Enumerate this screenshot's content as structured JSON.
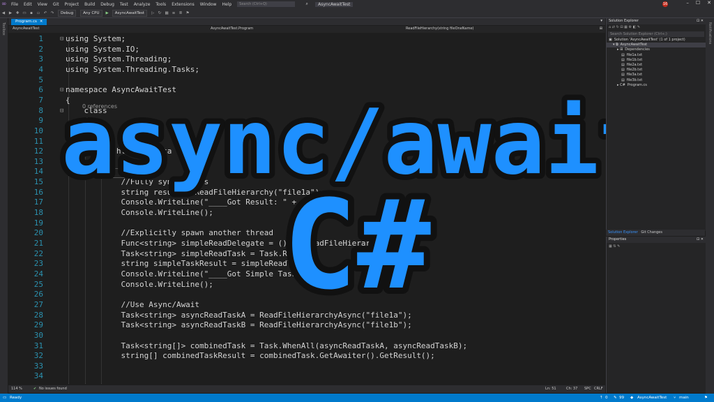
{
  "app": {
    "menu": [
      "File",
      "Edit",
      "View",
      "Git",
      "Project",
      "Build",
      "Debug",
      "Test",
      "Analyze",
      "Tools",
      "Extensions",
      "Window",
      "Help"
    ],
    "search_placeholder": "Search (Ctrl+Q)",
    "window_title": "AsyncAwaitTest",
    "notification_count": "16"
  },
  "toolbar": {
    "config": "Debug",
    "platform": "Any CPU",
    "run_target": "AsyncAwaitTest"
  },
  "side_strips": {
    "left": "Toolbox",
    "right": "Notifications"
  },
  "editor": {
    "tab_label": "Program.cs",
    "nav_project": "AsyncAwaitTest",
    "nav_class": "AsyncAwaitTest.Program",
    "nav_member": "ReadFileHierarchy(string fileOneName)",
    "codelens": "0 references",
    "lines": [
      {
        "n": "1",
        "fold": "⊟",
        "text": "using System;"
      },
      {
        "n": "2",
        "fold": "",
        "text": "using System.IO;"
      },
      {
        "n": "3",
        "fold": "",
        "text": "using System.Threading;"
      },
      {
        "n": "4",
        "fold": "",
        "text": "using System.Threading.Tasks;"
      },
      {
        "n": "5",
        "fold": "",
        "text": ""
      },
      {
        "n": "6",
        "fold": "⊟",
        "text": "namespace AsyncAwaitTest"
      },
      {
        "n": "7",
        "fold": "",
        "text": "{"
      },
      {
        "n": "8",
        "fold": "⊟",
        "text": "    class"
      },
      {
        "n": "9",
        "fold": "",
        "text": "    {"
      },
      {
        "n": "10",
        "fold": "",
        "text": ""
      },
      {
        "n": "11",
        "fold": "",
        "text": ""
      },
      {
        "n": "12",
        "fold": "",
        "text": "        ...hl       sta"
      },
      {
        "n": "13",
        "fold": "",
        "text": "           ...ne();"
      },
      {
        "n": "14",
        "fold": "",
        "text": ""
      },
      {
        "n": "15",
        "fold": "",
        "text": "            //Fully synchronous"
      },
      {
        "n": "16",
        "fold": "",
        "text": "            string result = ReadFileHierarchy(\"file1a\");"
      },
      {
        "n": "17",
        "fold": "",
        "text": "            Console.WriteLine(\"____Got Result: \" + re"
      },
      {
        "n": "18",
        "fold": "",
        "text": "            Console.WriteLine();"
      },
      {
        "n": "19",
        "fold": "",
        "text": ""
      },
      {
        "n": "20",
        "fold": "",
        "text": "            //Explicitly spawn another thread"
      },
      {
        "n": "21",
        "fold": "",
        "text": "            Func<string> simpleReadDelegate = () => ReadFileHierarchy"
      },
      {
        "n": "22",
        "fold": "",
        "text": "            Task<string> simpleReadTask = Task.Run("
      },
      {
        "n": "23",
        "fold": "",
        "text": "            string simpleTaskResult = simpleReadTas"
      },
      {
        "n": "24",
        "fold": "",
        "text": "            Console.WriteLine(\"____Got Simple Task Re"
      },
      {
        "n": "25",
        "fold": "",
        "text": "            Console.WriteLine();"
      },
      {
        "n": "26",
        "fold": "",
        "text": ""
      },
      {
        "n": "27",
        "fold": "",
        "text": "            //Use Async/Await"
      },
      {
        "n": "28",
        "fold": "",
        "text": "            Task<string> asyncReadTaskA = ReadFileHierarchyAsync(\"file1a\");"
      },
      {
        "n": "29",
        "fold": "",
        "text": "            Task<string> asyncReadTaskB = ReadFileHierarchyAsync(\"file1b\");"
      },
      {
        "n": "30",
        "fold": "",
        "text": ""
      },
      {
        "n": "31",
        "fold": "",
        "text": "            Task<string[]> combinedTask = Task.WhenAll(asyncReadTaskA, asyncReadTaskB);"
      },
      {
        "n": "32",
        "fold": "",
        "text": "            string[] combinedTaskResult = combinedTask.GetAwaiter().GetResult();"
      },
      {
        "n": "33",
        "fold": "",
        "text": ""
      },
      {
        "n": "34",
        "fold": "",
        "text": ""
      }
    ],
    "zoom": "114 %",
    "issues": "No issues found",
    "cursor_ln": "Ln: 51",
    "cursor_ch": "Ch: 37",
    "whitespace": "SPC",
    "line_ending": "CRLF"
  },
  "overlay": {
    "title": "async/await",
    "subtitle": "C#",
    "color": "#1e90ff",
    "outline": "#111111"
  },
  "solution_explorer": {
    "header": "Solution Explorer",
    "search_placeholder": "Search Solution Explorer (Ctrl+;)",
    "items": [
      {
        "label": "Solution 'AsyncAwaitTest' (1 of 1 project)",
        "indent": 0,
        "icon": "▣"
      },
      {
        "label": "AsyncAwaitTest",
        "indent": 1,
        "icon": "▾ ⧉"
      },
      {
        "label": "Dependencies",
        "indent": 2,
        "icon": "▸ ⊞"
      },
      {
        "label": "file1a.txt",
        "indent": 3,
        "icon": "▤"
      },
      {
        "label": "file1b.txt",
        "indent": 3,
        "icon": "▤"
      },
      {
        "label": "file2a.txt",
        "indent": 3,
        "icon": "▤"
      },
      {
        "label": "file2b.txt",
        "indent": 3,
        "icon": "▤"
      },
      {
        "label": "file3a.txt",
        "indent": 3,
        "icon": "▤"
      },
      {
        "label": "file3b.txt",
        "indent": 3,
        "icon": "▤"
      },
      {
        "label": "Program.cs",
        "indent": 2,
        "icon": "▸ C#"
      }
    ],
    "tab_active": "Solution Explorer",
    "tab_other": "Git Changes"
  },
  "properties": {
    "header": "Properties"
  },
  "statusbar": {
    "ready": "Ready",
    "add_source": "Add to Source Control",
    "branch": "main",
    "project": "AsyncAwaitTest",
    "changes": "0",
    "errors": "99"
  }
}
